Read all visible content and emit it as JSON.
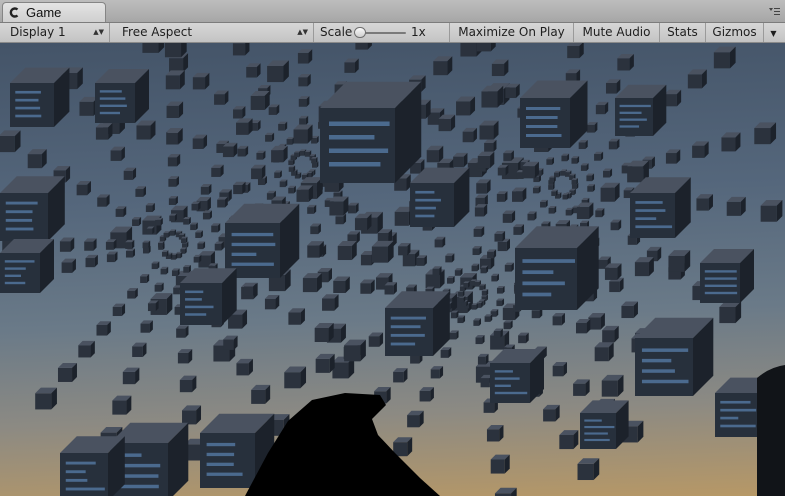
{
  "tab": {
    "title": "Game",
    "icon": "game-controller-icon",
    "menu_icon": "panel-menu-icon"
  },
  "toolbar": {
    "display": "Display 1",
    "aspect": "Free Aspect",
    "scale_label": "Scale",
    "scale_value": "1x",
    "maximize_on_play": "Maximize On Play",
    "mute_audio": "Mute Audio",
    "stats": "Stats",
    "gizmos": "Gizmos"
  },
  "viewport": {
    "scene": "Game view render: radial tunnel of dark cube clusters, dark occluding shape in foreground",
    "colors": {
      "sky_top": "#445468",
      "sky_bottom": "#b79866",
      "cube": "#2b323d",
      "cube_highlight": "#4b6a8e",
      "occluder": "#000000"
    }
  }
}
